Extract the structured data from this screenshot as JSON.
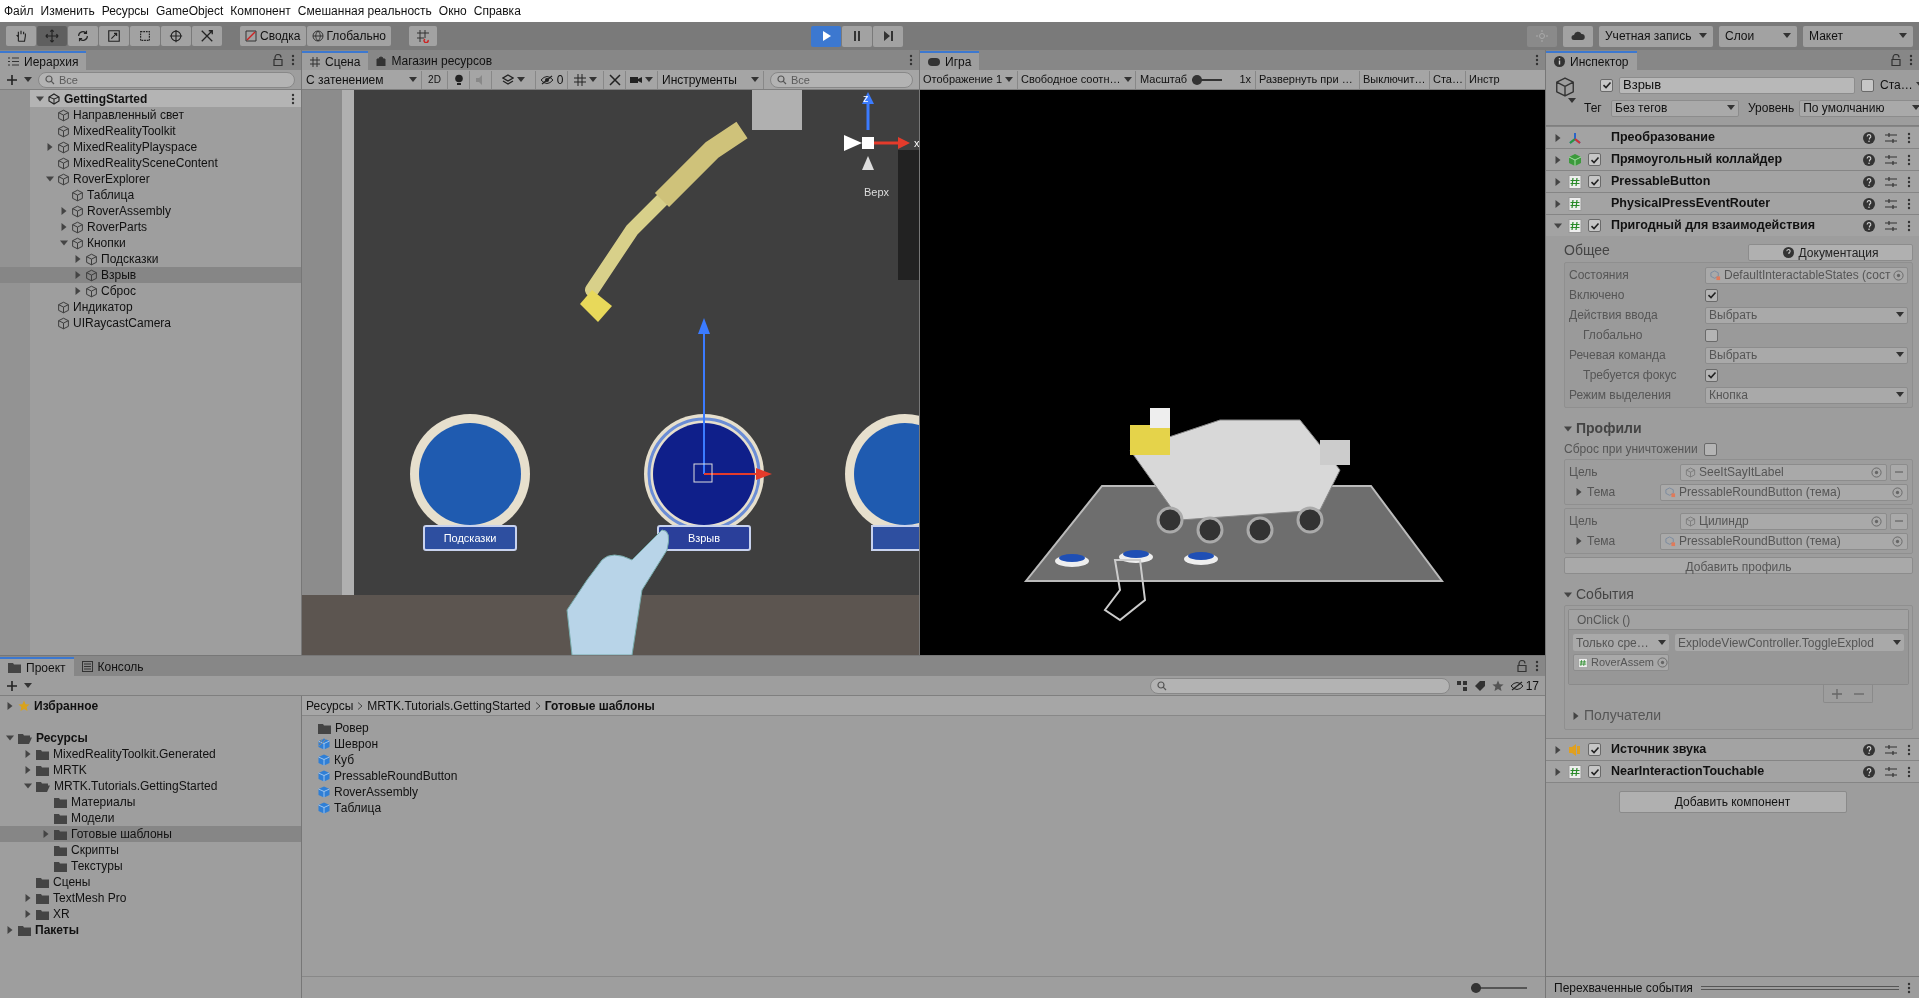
{
  "menu_bar": [
    "Файл",
    "Изменить",
    "Ресурсы",
    "GameObject",
    "Компонент",
    "Смешанная реальность",
    "Окно",
    "Справка"
  ],
  "toolbar": {
    "tools": [
      {
        "kind": "hand",
        "selected": false
      },
      {
        "kind": "move",
        "selected": true
      },
      {
        "kind": "rotate",
        "selected": false
      },
      {
        "kind": "scale",
        "selected": false
      },
      {
        "kind": "rect",
        "selected": false
      },
      {
        "kind": "transform",
        "selected": false
      },
      {
        "kind": "custom",
        "selected": false
      }
    ],
    "pivot": "Сводка",
    "space": "Глобально",
    "play_controls": [
      {
        "kind": "play",
        "selected": true
      },
      {
        "kind": "pause",
        "selected": false
      },
      {
        "kind": "step",
        "selected": false
      }
    ],
    "account": "Учетная запись",
    "layers": "Слои",
    "layout": "Макет"
  },
  "hierarchy": {
    "tab": "Иерархия",
    "search": {
      "placeholder": "Все"
    },
    "scene": {
      "label": "GettingStarted",
      "expanded": true,
      "children": [
        {
          "label": "Направленный свет",
          "selected": false
        },
        {
          "label": "MixedRealityToolkit",
          "selected": false
        },
        {
          "label": "MixedRealityPlayspace",
          "expanded": false,
          "selected": false
        },
        {
          "label": "MixedRealitySceneContent",
          "selected": false
        },
        {
          "label": "RoverExplorer",
          "expanded": true,
          "selected": false,
          "children": [
            {
              "label": "Таблица",
              "selected": false
            },
            {
              "label": "RoverAssembly",
              "expanded": false,
              "selected": false
            },
            {
              "label": "RoverParts",
              "expanded": false,
              "selected": false
            },
            {
              "label": "Кнопки",
              "expanded": true,
              "selected": false,
              "children": [
                {
                  "label": "Подсказки",
                  "expanded": false,
                  "selected": false
                },
                {
                  "label": "Взрыв",
                  "expanded": false,
                  "selected": true
                },
                {
                  "label": "Сброс",
                  "expanded": false,
                  "selected": false
                }
              ]
            }
          ]
        },
        {
          "label": "Индикатор",
          "selected": false
        },
        {
          "label": "UIRaycastCamera",
          "selected": false
        }
      ]
    }
  },
  "scene_view": {
    "tabs": [
      {
        "label": "Сцена",
        "selected": true
      },
      {
        "label": "Магазин ресурсов",
        "selected": false
      }
    ],
    "toolbar": {
      "shading": "С затенением",
      "mode_2d": "2D",
      "hidden_count": "0",
      "tools": "Инструменты",
      "search": {
        "placeholder": "Все"
      }
    },
    "button_labels": [
      "Подсказки",
      "Взрыв"
    ],
    "gizmo": {
      "x_label": "x",
      "z_label": "z",
      "view_label": "Верх"
    }
  },
  "game_view": {
    "tab": "Игра",
    "toolbar": {
      "display": "Отображение 1",
      "aspect": "Свободное соотн…",
      "scale_label": "Масштаб",
      "scale": {
        "level": 0
      },
      "scale_value": "1x",
      "maximize": "Развернуть при …",
      "mute": "Выключит…",
      "stats": "Ста…",
      "gizmos": "Инстр"
    }
  },
  "inspector": {
    "tab": "Инспектор",
    "object": {
      "active": true,
      "name": "Взрыв",
      "static": false,
      "static_label": "Ста…",
      "tag_label": "Тег",
      "tag": "Без тегов",
      "layer_label": "Уровень",
      "layer": "По умолчанию"
    },
    "components": [
      {
        "kind": "transform",
        "name": "Преобразование",
        "expanded": false
      },
      {
        "kind": "collider",
        "name": "Прямоугольный коллайдер",
        "enabled": true,
        "expanded": false
      },
      {
        "kind": "script",
        "name": "PressableButton",
        "enabled": true,
        "expanded": false
      },
      {
        "kind": "script",
        "name": "PhysicalPressEventRouter",
        "expanded": false
      },
      {
        "kind": "script",
        "name": "Пригодный для взаимодействия",
        "enabled": true,
        "expanded": true,
        "body": {
          "general_title": "Общее",
          "docs_button": "Документация",
          "fields": [
            {
              "kind": "object",
              "label": "Состояния",
              "value": "DefaultInteractableStates (сост",
              "indented": false
            },
            {
              "kind": "check",
              "label": "Включено",
              "checked": true,
              "indented": false
            },
            {
              "kind": "dropdown",
              "label": "Действия ввода",
              "value": "Выбрать",
              "indented": false
            },
            {
              "kind": "check",
              "label": "Глобально",
              "checked": false,
              "indented": true
            },
            {
              "kind": "dropdown",
              "label": "Речевая команда",
              "value": "Выбрать",
              "indented": false
            },
            {
              "kind": "check",
              "label": "Требуется фокус",
              "checked": true,
              "indented": true
            },
            {
              "kind": "dropdown",
              "label": "Режим выделения",
              "value": "Кнопка",
              "indented": false
            }
          ],
          "profiles": {
            "title": "Профили",
            "expanded": true,
            "reset_label": "Сброс при уничтожении",
            "reset": false,
            "items": [
              {
                "target_label": "Цель",
                "target": "SeeItSayItLabel",
                "theme_label": "Тема",
                "theme": "PressableRoundButton (тема)",
                "theme_expanded": false
              },
              {
                "target_label": "Цель",
                "target": "Цилиндр",
                "theme_label": "Тема",
                "theme": "PressableRoundButton (тема)",
                "theme_expanded": false
              }
            ],
            "add_button": "Добавить профиль"
          },
          "events": {
            "title": "События",
            "expanded": true,
            "event": "OnClick ()",
            "runtime": "Только сре…",
            "function": "ExplodeViewController.ToggleExplod",
            "object": "RoverAssem",
            "receivers": "Получатели",
            "receivers_expanded": false
          }
        }
      },
      {
        "kind": "audio",
        "name": "Источник звука",
        "enabled": true,
        "expanded": false
      },
      {
        "kind": "script",
        "name": "NearInteractionTouchable",
        "enabled": true,
        "expanded": false
      }
    ],
    "add_component": "Добавить компонент",
    "footer": "Перехваченные события"
  },
  "project": {
    "tabs": [
      {
        "kind": "folder",
        "label": "Проект",
        "selected": true
      },
      {
        "kind": "console",
        "label": "Консоль",
        "selected": false
      }
    ],
    "hidden_count": "17",
    "tree": [
      {
        "kind": "favorites",
        "label": "Избранное",
        "expanded": false,
        "selected": false
      },
      {
        "kind": "folder",
        "label": "Ресурсы",
        "expanded": true,
        "selected": false,
        "children": [
          {
            "kind": "folder",
            "label": "MixedRealityToolkit.Generated",
            "expanded": false,
            "selected": false
          },
          {
            "kind": "folder",
            "label": "MRTK",
            "expanded": false,
            "selected": false
          },
          {
            "kind": "folder",
            "label": "MRTK.Tutorials.GettingStarted",
            "expanded": true,
            "selected": false,
            "children": [
              {
                "kind": "folder",
                "label": "Материалы",
                "selected": false
              },
              {
                "kind": "folder",
                "label": "Модели",
                "selected": false
              },
              {
                "kind": "folder",
                "label": "Готовые шаблоны",
                "expanded": false,
                "selected": true
              },
              {
                "kind": "folder",
                "label": "Скрипты",
                "selected": false
              },
              {
                "kind": "folder",
                "label": "Текстуры",
                "selected": false
              }
            ]
          },
          {
            "kind": "folder",
            "label": "Сцены",
            "selected": false
          },
          {
            "kind": "folder",
            "label": "TextMesh Pro",
            "expanded": false,
            "selected": false
          },
          {
            "kind": "folder",
            "label": "XR",
            "expanded": false,
            "selected": false
          }
        ]
      },
      {
        "kind": "folder",
        "label": "Пакеты",
        "expanded": false,
        "selected": false
      }
    ],
    "breadcrumb": [
      "Ресурсы",
      "MRTK.Tutorials.GettingStarted",
      "Готовые шаблоны"
    ],
    "items": [
      {
        "kind": "folder",
        "label": "Ровер"
      },
      {
        "kind": "prefab_variant",
        "label": "Шеврон"
      },
      {
        "kind": "prefab",
        "label": "Куб"
      },
      {
        "kind": "prefab",
        "label": "PressableRoundButton"
      },
      {
        "kind": "prefab",
        "label": "RoverAssembly"
      },
      {
        "kind": "prefab",
        "label": "Таблица"
      }
    ],
    "icon_size": {
      "level": 0
    }
  }
}
